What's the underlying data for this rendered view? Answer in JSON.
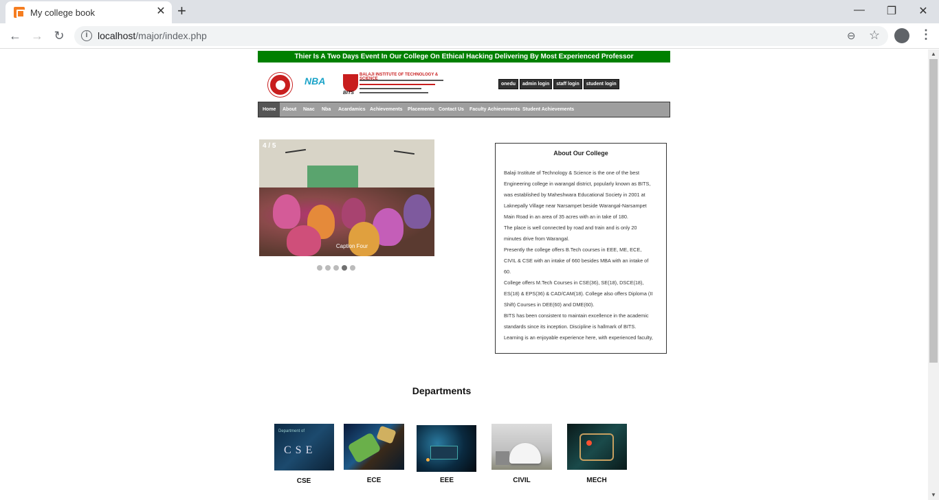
{
  "browser": {
    "tab_title": "My college book",
    "tab_close": "✕",
    "new_tab": "+",
    "url_host": "localhost",
    "url_path": "/major/index.php",
    "window_minimize": "—",
    "window_restore": "❐",
    "window_close": "✕"
  },
  "page": {
    "marquee": "Thier Is A Two Days Event In Our College On Ethical Hacking Delivering By Most Experienced Professor",
    "logos": {
      "nba": "NBA",
      "bits_name": "BALAJI INSTITUTE OF TECHNOLOGY & SCIENCE",
      "bits_short": "BITS"
    },
    "quick_links": [
      "onedu",
      "admin login",
      "staff login",
      "student login"
    ],
    "nav": [
      "Home",
      "About",
      "Naac",
      "Nba",
      "Acardamics",
      "Achievements",
      "Placements",
      "Contact Us",
      "Faculty Achievements",
      "Student Achievements"
    ],
    "slider": {
      "counter": "4 / 5",
      "caption": "Caption Four",
      "total": 5,
      "active_index": 3
    },
    "about": {
      "title": "About Our College",
      "lines": [
        "Balaji Institute of Technology & Science is the one of the best",
        "Engineering college in warangal district, popularly known as BITS,",
        "was established by Maheshwara Educational Society in 2001 at",
        "Laknepally Village near Narsampet beside Warangal-Narsampet",
        "Main Road in an area of 35 acres with an in take of 180.",
        "The place is well connected by road and train and is only 20",
        "minutes drive from Warangal.",
        "Presently the college offers B.Tech courses in EEE, ME, ECE,",
        "CIVIL & CSE with an intake of 660 besides MBA with an intake of",
        "60.",
        "College offers M.Tech Courses in CSE(36), SE(18), DSCE(18),",
        "ES(18) & EPS(36) & CAD/CAM(18). College also offers Diploma (II",
        "Shift) Courses in DEE(60) and DME(60).",
        "BITS has been consistent to maintain excellence in the academic",
        "standards since its inception. Discipline is hallmark of BITS.",
        "Learning is an enjoyable experience here, with experienced faculty,"
      ]
    },
    "departments_title": "Departments",
    "departments": [
      {
        "label": "CSE",
        "img_text": "C S E",
        "img_top_text": "Department of"
      },
      {
        "label": "ECE"
      },
      {
        "label": "EEE"
      },
      {
        "label": "CIVIL"
      },
      {
        "label": "MECH"
      }
    ]
  },
  "colors": {
    "marquee_bg": "#008000",
    "nav_bg": "#9e9e9e",
    "nav_active": "#555555"
  }
}
